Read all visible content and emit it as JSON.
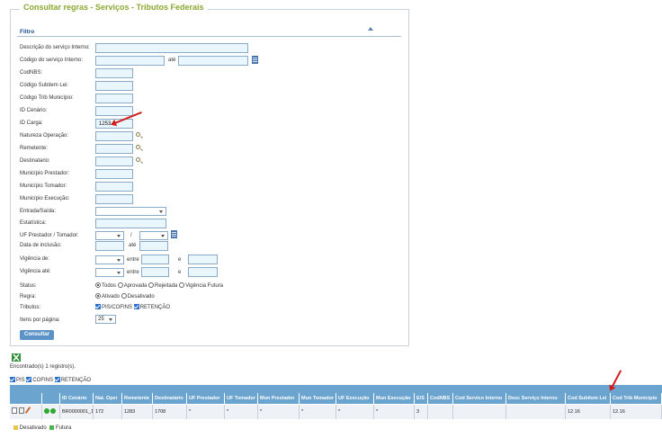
{
  "panel_title": "Consultar regras - Serviços - Tributos Federais",
  "filtro": "Filtro",
  "labels": {
    "desc_interno": "Descrição do serviço Interno:",
    "cod_interno": "Código do serviço Interno:",
    "ate": "até",
    "codnbs": "CodNBS:",
    "cod_subitem": "Código Subitem Lei:",
    "cod_trib": "Código Trib Município:",
    "id_cenario": "ID Cenário:",
    "id_carga": "ID Carga:",
    "natureza": "Natureza Operação:",
    "remetente": "Remetente:",
    "destinatario": "Destinatario:",
    "mun_prestador": "Município Prestador:",
    "mun_tomador": "Município Tomador:",
    "mun_execucao": "Município Execução:",
    "entrada_saida": "Entrada/Saída:",
    "estatistica": "Estatística:",
    "uf_prest_tom": "UF Prestador / Tomador:",
    "slash": "/",
    "data_inclusao": "Data de inclusão:",
    "vig_de": "Vigência de:",
    "vig_ate": "Vigência até:",
    "entre": "entre",
    "e": "e",
    "status": "Status:",
    "regra": "Regra:",
    "tributos": "Tributos:",
    "itens_pagina": "Itens por página:"
  },
  "values": {
    "id_carga": "1253",
    "itens_pagina": "25"
  },
  "status_options": [
    "Todos",
    "Aprovada",
    "Rejeitada",
    "Vigência Futura"
  ],
  "regra_options": [
    "Ativado",
    "Desativado"
  ],
  "tributos_options": [
    "PIS/COFINS",
    "RETENÇÃO"
  ],
  "consultar": "Consultar",
  "encontrados": "Encontrado(s) 1 registro(s).",
  "filters": [
    "PIS",
    "COFINS",
    "RETENÇÃO"
  ],
  "table": {
    "headers": [
      "ID Cenário",
      "Nat. Oper",
      "Remetente",
      "Destinatário",
      "UF Prestador",
      "UF Tomador",
      "Mun Prestador",
      "Mun Tomador",
      "UF Execução",
      "Mun Execução",
      "E/S",
      "CodNBS",
      "Cod Servico Interno",
      "Desc Serviço Interno",
      "Cod Subitem Lei",
      "Cod Trib Municipio"
    ],
    "row": [
      "BR0000001_1",
      "172",
      "1283",
      "1708",
      "*",
      "*",
      "*",
      "*",
      "*",
      "*",
      "3",
      "",
      "",
      "",
      "12.16",
      "12.16"
    ]
  },
  "legend": [
    "Desativado",
    "Futura"
  ],
  "colors": {
    "accent": "#8aa832",
    "header": "#6aa4cf",
    "input": "#eaf6fd",
    "arrow": "#d21d1d"
  }
}
